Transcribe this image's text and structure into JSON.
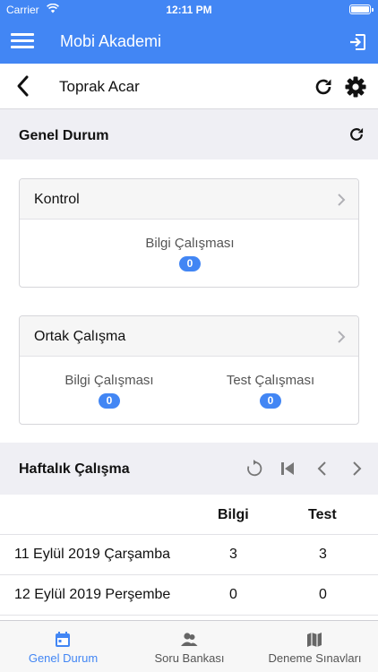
{
  "status_bar": {
    "carrier": "Carrier",
    "time": "12:11 PM"
  },
  "nav": {
    "title": "Mobi Akademi",
    "menu_icon": "hamburger-menu-icon",
    "logout_icon": "sign-out-icon"
  },
  "student": {
    "name": "Toprak Acar"
  },
  "overview": {
    "title": "Genel Durum"
  },
  "cards": {
    "kontrol": {
      "title": "Kontrol",
      "stats": [
        {
          "label": "Bilgi Çalışması",
          "value": "0"
        }
      ]
    },
    "ortak": {
      "title": "Ortak Çalışma",
      "stats": [
        {
          "label": "Bilgi Çalışması",
          "value": "0"
        },
        {
          "label": "Test Çalışması",
          "value": "0"
        }
      ]
    }
  },
  "weekly": {
    "title": "Haftalık Çalışma",
    "columns": [
      "",
      "Bilgi",
      "Test"
    ],
    "rows": [
      {
        "date": "11 Eylül 2019 Çarşamba",
        "bilgi": "3",
        "test": "3"
      },
      {
        "date": "12 Eylül 2019 Perşembe",
        "bilgi": "0",
        "test": "0"
      }
    ]
  },
  "tabs": [
    {
      "label": "Genel Durum",
      "icon": "calendar-icon",
      "active": true
    },
    {
      "label": "Soru Bankası",
      "icon": "users-icon",
      "active": false
    },
    {
      "label": "Deneme Sınavları",
      "icon": "map-icon",
      "active": false
    }
  ],
  "colors": {
    "primary": "#4286f4",
    "background": "#efeff4"
  }
}
